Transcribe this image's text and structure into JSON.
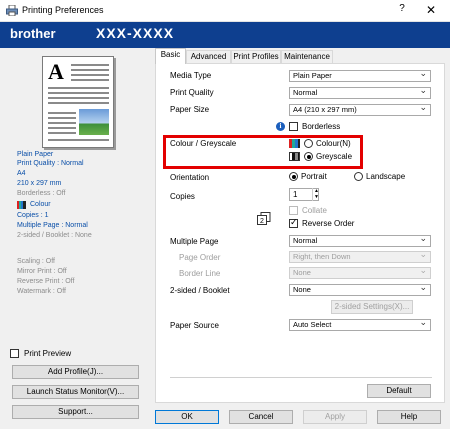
{
  "window": {
    "title": "Printing Preferences",
    "help": "?",
    "close": "✕"
  },
  "brand": {
    "logo": "brother",
    "model": "XXX-XXXX"
  },
  "summary": {
    "paper": "Plain Paper",
    "quality": "Print Quality : Normal",
    "size": "A4",
    "dims": "210 x 297 mm",
    "borderless": "Borderless : Off",
    "colour": "Colour",
    "copies": "Copies : 1",
    "multiple": "Multiple Page : Normal",
    "twosided": "2-sided / Booklet : None",
    "scaling": "Scaling : Off",
    "mirror": "Mirror Print : Off",
    "reverse": "Reverse Print : Off",
    "watermark": "Watermark : Off"
  },
  "left": {
    "print_preview": "Print Preview",
    "add_profile": "Add Profile(J)...",
    "status_monitor": "Launch Status Monitor(V)...",
    "support": "Support..."
  },
  "tabs": [
    "Basic",
    "Advanced",
    "Print Profiles",
    "Maintenance"
  ],
  "basic": {
    "media_type_label": "Media Type",
    "media_type": "Plain Paper",
    "print_quality_label": "Print Quality",
    "print_quality": "Normal",
    "paper_size_label": "Paper Size",
    "paper_size": "A4 (210 x 297 mm)",
    "borderless": "Borderless",
    "colour_label": "Colour / Greyscale",
    "colour_option": "Colour(N)",
    "greyscale_option": "Greyscale",
    "orientation_label": "Orientation",
    "portrait": "Portrait",
    "landscape": "Landscape",
    "copies_label": "Copies",
    "copies": "1",
    "collate": "Collate",
    "reverse_order": "Reverse Order",
    "multiple_page_label": "Multiple Page",
    "multiple_page": "Normal",
    "page_order_label": "Page Order",
    "page_order": "Right, then Down",
    "border_line_label": "Border Line",
    "border_line": "None",
    "twosided_label": "2-sided / Booklet",
    "twosided": "None",
    "twosided_settings": "2-sided Settings(X)...",
    "paper_source_label": "Paper Source",
    "paper_source": "Auto Select",
    "default": "Default"
  },
  "footer": {
    "ok": "OK",
    "cancel": "Cancel",
    "apply": "Apply",
    "help": "Help"
  },
  "colors": {
    "brand_bar": "#0e3f8f",
    "highlight": "#e30000",
    "summary_text": "#0a4fa8"
  }
}
